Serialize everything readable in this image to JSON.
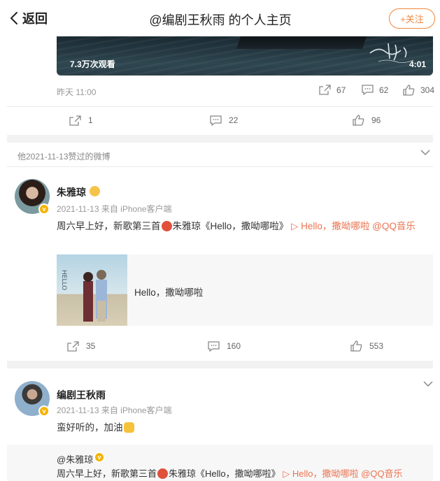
{
  "header": {
    "back_label": "返回",
    "title": "@编剧王秋雨 的个人主页",
    "follow_label": "+关注"
  },
  "video_post": {
    "views": "7.3万次观看",
    "duration": "4:01",
    "time": "昨天 11:00",
    "repost_count": "67",
    "comment_count": "62",
    "like_count": "304"
  },
  "post1_actions": {
    "repost": "1",
    "comment": "22",
    "like": "96"
  },
  "liked_section": {
    "label": "他2021-11-13赞过的微博"
  },
  "post2": {
    "author": "朱雅琼",
    "time": "2021-11-13",
    "source": "来自 iPhone客户端",
    "text_a": "周六早上好，新歌第三首",
    "text_b": "朱雅琼《Hello，撒呦哪啦》",
    "link_text": "▷ Hello，撒呦哪啦 @QQ音乐",
    "card_title": "Hello，撒呦哪啦",
    "repost": "35",
    "comment": "160",
    "like": "553"
  },
  "post3": {
    "author": "编剧王秋雨",
    "time": "2021-11-13",
    "source": "来自 iPhone客户端",
    "text": "蛮好听的，加油",
    "quoted_author": "@朱雅琼",
    "quoted_text_a": "周六早上好，新歌第三首",
    "quoted_text_b": "朱雅琼《Hello，撒呦哪啦》",
    "quoted_link": "▷ Hello，撒呦哪啦 @QQ音乐"
  },
  "colors": {
    "accent": "#f0873b",
    "link": "#eb7350",
    "verified": "#f5b300"
  }
}
